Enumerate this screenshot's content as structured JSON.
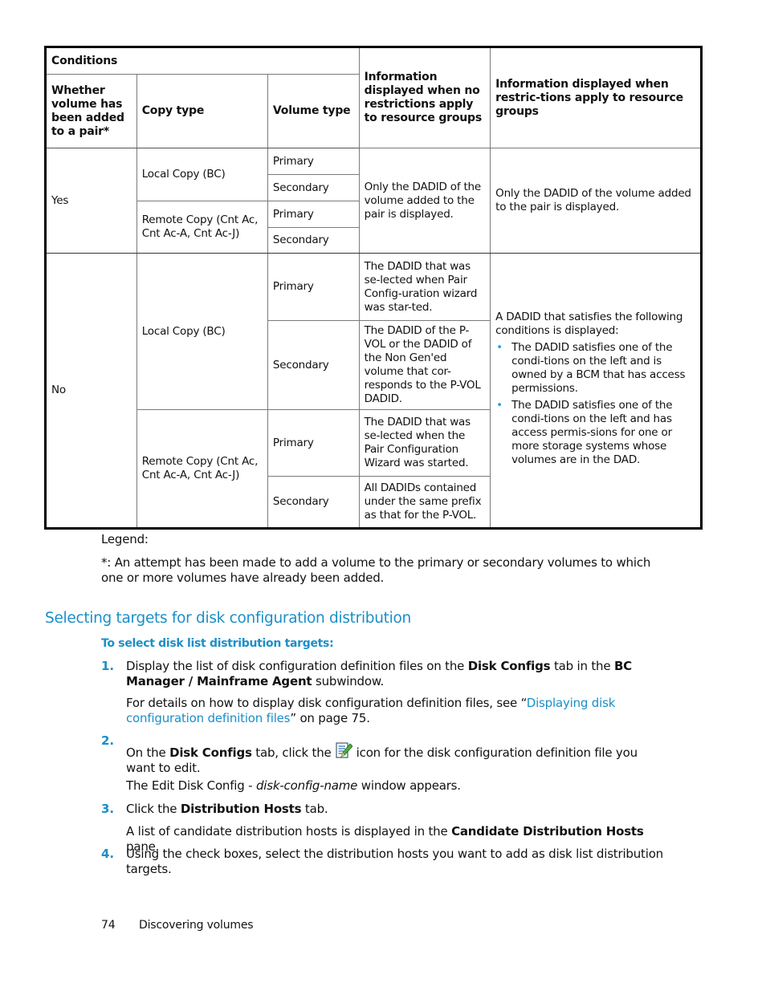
{
  "table": {
    "headers": {
      "conditions": "Conditions",
      "whether_added": "Whether volume has been added to a pair*",
      "copy_type": "Copy type",
      "volume_type": "Volume type",
      "info_no_restrictions": "Information displayed when no restrictions apply to resource groups",
      "info_restrictions": "Information displayed when restric-tions apply to resource groups"
    },
    "yes_group": {
      "added": "Yes",
      "local_copy": "Local Copy (BC)",
      "remote_copy": "Remote Copy (Cnt Ac, Cnt Ac-A, Cnt Ac-J)",
      "primary": "Primary",
      "secondary": "Secondary",
      "info_no_restrictions": "Only the DADID of the volume added to the pair is displayed.",
      "info_restrictions": "Only the DADID of the volume added to the pair is displayed."
    },
    "no_group": {
      "added": "No",
      "local_copy": "Local Copy (BC)",
      "remote_copy": "Remote Copy (Cnt Ac, Cnt Ac-A, Cnt Ac-J)",
      "primary": "Primary",
      "secondary": "Secondary",
      "local_primary_info": "The DADID that was se-lected when Pair Config-uration wizard was star-ted.",
      "local_secondary_info": "The DADID of the P-VOL or the DADID of the Non Gen'ed volume that cor-responds to the P-VOL DADID.",
      "remote_primary_info": "The DADID that was se-lected when the Pair Configuration Wizard was started.",
      "remote_secondary_info": "All DADIDs contained under the same prefix as that for the P-VOL.",
      "restrictions_intro": "A DADID that satisfies the following conditions is displayed:",
      "restrictions_bullets": [
        "The DADID satisfies one of the condi-tions on the left and  is owned by a BCM that has access permissions.",
        "The DADID satisfies one of the condi-tions on the left and has access permis-sions for one or more storage systems whose volumes are in the DAD."
      ]
    }
  },
  "legend": {
    "label": "Legend:",
    "note": "*: An attempt has been made to add a volume to the primary or secondary volumes to which one or more volumes have already been added."
  },
  "section": {
    "title": "Selecting targets for disk configuration distribution",
    "procedure_title": "To select disk list distribution targets:",
    "steps": [
      {
        "number": "1.",
        "parts": [
          "Display the list of disk configuration definition files on the ",
          "Disk Configs",
          " tab in the ",
          "BC Manager / Mainframe Agent",
          " subwindow."
        ],
        "note_parts": [
          "For details on how to display disk configuration definition files, see “",
          "Displaying disk configuration definition files",
          "” on page 75."
        ]
      },
      {
        "number": "2.",
        "parts": [
          "On the ",
          "Disk Configs",
          " tab, click the ",
          " icon for the disk configuration definition file you want to edit."
        ],
        "icon": "edit-document-icon",
        "note_parts": [
          "The Edit Disk Config - ",
          "disk-config-name",
          " window appears."
        ]
      },
      {
        "number": "3.",
        "parts": [
          "Click the ",
          "Distribution Hosts",
          " tab."
        ],
        "note_parts": [
          "A list of candidate distribution hosts is displayed in the ",
          "Candidate Distribution Hosts",
          " pane."
        ]
      },
      {
        "number": "4.",
        "parts": [
          "Using the check boxes, select the distribution hosts you want to add as disk list distribution targets."
        ]
      }
    ]
  },
  "footer": {
    "page_number": "74",
    "chapter": "Discovering volumes"
  },
  "colors": {
    "accent": "#1a8fc9",
    "text": "#111111"
  }
}
